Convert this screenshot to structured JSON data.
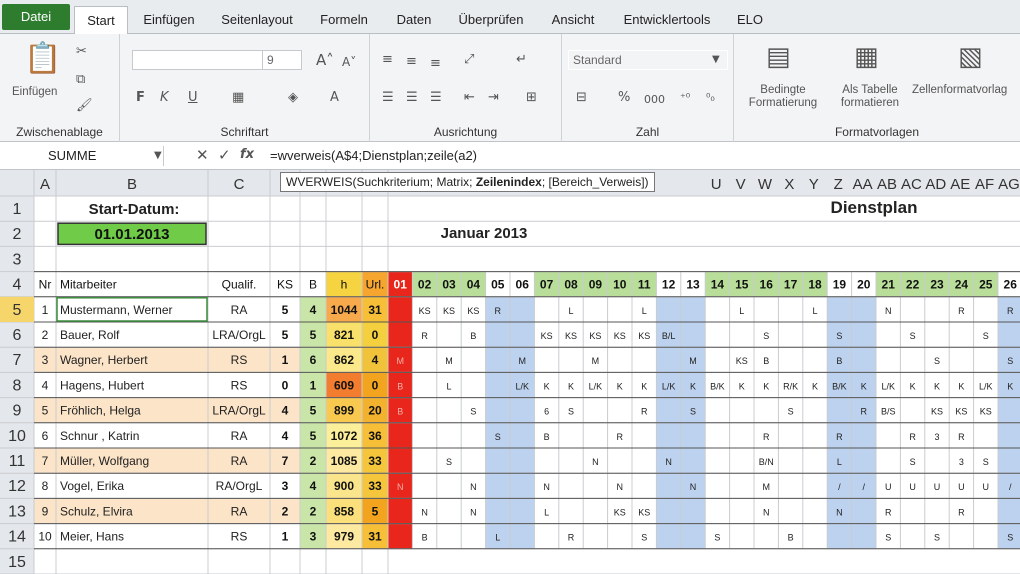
{
  "tabs": [
    "Datei",
    "Start",
    "Einfügen",
    "Seitenlayout",
    "Formeln",
    "Daten",
    "Überprüfen",
    "Ansicht",
    "Entwicklertools",
    "ELO"
  ],
  "ribbon": {
    "paste_label": "Einfügen",
    "clipboard_label": "Zwischenablage",
    "font_size": "9",
    "font_group_label": "Schriftart",
    "bold": "F",
    "italic": "K",
    "underline": "U",
    "align_group_label": "Ausrichtung",
    "number_format": "Standard",
    "percent": "%",
    "thousands": "000",
    "number_group_label": "Zahl",
    "cond_format_label": "Bedingte Formatierung",
    "as_table_label": "Als Tabelle formatieren",
    "cell_styles_label": "Zellenformatvorlag",
    "styles_group_label": "Formatvorlagen"
  },
  "formula_bar": {
    "name_box": "SUMME",
    "fx": "fx",
    "content": "=wverweis(A$4;Dienstplan;zeile(a2)"
  },
  "tooltip": {
    "pre": "WVERWEIS(Suchkriterium; Matrix; ",
    "bold": "Zeilenindex",
    "post": "; [Bereich_Verweis])"
  },
  "sheet": {
    "col_headers": [
      "A",
      "B",
      "C",
      "",
      "",
      "",
      "",
      "",
      "",
      "",
      "",
      "",
      "",
      "",
      "",
      "",
      "",
      "",
      "",
      "",
      "",
      "",
      "",
      "",
      "",
      "",
      "",
      "",
      "U",
      "V",
      "W",
      "X",
      "Y",
      "Z",
      "AA",
      "AB",
      "AC",
      "AD",
      "AE",
      "AF",
      "AG"
    ],
    "row_numbers": [
      "1",
      "2",
      "3",
      "4",
      "5",
      "6",
      "7",
      "8",
      "9",
      "10",
      "11",
      "12",
      "13",
      "14",
      "15"
    ],
    "start_label": "Start-Datum:",
    "start_date": "01.01.2013",
    "month_label": "Januar 2013",
    "plan_title": "Dienstplan",
    "headers": {
      "nr": "Nr",
      "name": "Mitarbeiter",
      "qual": "Qualif.",
      "ks": "KS",
      "b": "B",
      "h": "h",
      "url": "Url."
    },
    "days": [
      "01",
      "02",
      "03",
      "04",
      "05",
      "06",
      "07",
      "08",
      "09",
      "10",
      "11",
      "12",
      "13",
      "14",
      "15",
      "16",
      "17",
      "18",
      "19",
      "20",
      "21",
      "22",
      "23",
      "24",
      "25",
      "26"
    ],
    "weekend_days": [
      "05",
      "06",
      "12",
      "13",
      "19",
      "20",
      "26"
    ],
    "employees": [
      {
        "nr": "1",
        "name": "Mustermann, Werner",
        "qual": "RA",
        "ks": "5",
        "b": "4",
        "h": "1044",
        "url": "31",
        "cells": [
          "",
          "KS",
          "KS",
          "KS",
          "R",
          "",
          "",
          "L",
          "",
          "",
          "L",
          "",
          "",
          "",
          "L",
          "",
          "",
          "L",
          "",
          "",
          "N",
          "",
          "",
          "R",
          "",
          "R"
        ]
      },
      {
        "nr": "2",
        "name": "Bauer, Rolf",
        "qual": "LRA/OrgL",
        "ks": "5",
        "b": "5",
        "h": "821",
        "url": "0",
        "cells": [
          "",
          "R",
          "",
          "B",
          "",
          "",
          "KS",
          "KS",
          "KS",
          "KS",
          "KS",
          "B/L",
          "",
          "",
          "",
          "S",
          "",
          "",
          "S",
          "",
          "",
          "S",
          "",
          "",
          "S",
          ""
        ]
      },
      {
        "nr": "3",
        "name": "Wagner, Herbert",
        "qual": "RS",
        "ks": "1",
        "b": "6",
        "h": "862",
        "url": "4",
        "cells": [
          "M",
          "",
          "M",
          "",
          "",
          "M",
          "",
          "",
          "M",
          "",
          "",
          "",
          "M",
          "",
          "KS",
          "B",
          "",
          "",
          "B",
          "",
          "",
          "",
          "S",
          "",
          "",
          "S"
        ]
      },
      {
        "nr": "4",
        "name": "Hagens, Hubert",
        "qual": "RS",
        "ks": "0",
        "b": "1",
        "h": "609",
        "url": "0",
        "cells": [
          "B",
          "",
          "L",
          "",
          "",
          "L/K",
          "K",
          "K",
          "L/K",
          "K",
          "K",
          "L/K",
          "K",
          "B/K",
          "K",
          "K",
          "R/K",
          "K",
          "B/K",
          "K",
          "L/K",
          "K",
          "K",
          "K",
          "L/K",
          "K"
        ]
      },
      {
        "nr": "5",
        "name": "Fröhlich, Helga",
        "qual": "LRA/OrgL",
        "ks": "4",
        "b": "5",
        "h": "899",
        "url": "20",
        "cells": [
          "B",
          "",
          "",
          "S",
          "",
          "",
          "6",
          "S",
          "",
          "",
          "R",
          "",
          "S",
          "",
          "",
          "",
          "S",
          "",
          "",
          "R",
          "B/S",
          "",
          "KS",
          "KS",
          "KS",
          ""
        ]
      },
      {
        "nr": "6",
        "name": "Schnur , Katrin",
        "qual": "RA",
        "ks": "4",
        "b": "5",
        "h": "1072",
        "url": "36",
        "cells": [
          "",
          "",
          "",
          "",
          "S",
          "",
          "B",
          "",
          "",
          "R",
          "",
          "",
          "",
          "",
          "",
          "R",
          "",
          "",
          "R",
          "",
          "",
          "R",
          "3",
          "R",
          "",
          ""
        ]
      },
      {
        "nr": "7",
        "name": "Müller, Wolfgang",
        "qual": "RA",
        "ks": "7",
        "b": "2",
        "h": "1085",
        "url": "33",
        "cells": [
          "",
          "",
          "S",
          "",
          "",
          "",
          "",
          "",
          "N",
          "",
          "",
          "N",
          "",
          "",
          "",
          "B/N",
          "",
          "",
          "L",
          "",
          "",
          "S",
          "",
          "3",
          "S",
          ""
        ]
      },
      {
        "nr": "8",
        "name": "Vogel, Erika",
        "qual": "RA/OrgL",
        "ks": "3",
        "b": "4",
        "h": "900",
        "url": "33",
        "cells": [
          "N",
          "",
          "",
          "N",
          "",
          "",
          "N",
          "",
          "",
          "N",
          "",
          "",
          "N",
          "",
          "",
          "M",
          "",
          "",
          "/",
          "/",
          "U",
          "U",
          "U",
          "U",
          "U",
          "/"
        ]
      },
      {
        "nr": "9",
        "name": "Schulz, Elvira",
        "qual": "RA",
        "ks": "2",
        "b": "2",
        "h": "858",
        "url": "5",
        "cells": [
          "",
          "N",
          "",
          "N",
          "",
          "",
          "L",
          "",
          "",
          "KS",
          "KS",
          "",
          "",
          "",
          "",
          "N",
          "",
          "",
          "N",
          "",
          "R",
          "",
          "",
          "R",
          "",
          ""
        ]
      },
      {
        "nr": "10",
        "name": "Meier, Hans",
        "qual": "RS",
        "ks": "1",
        "b": "3",
        "h": "979",
        "url": "31",
        "cells": [
          "",
          "B",
          "",
          "",
          "L",
          "",
          "",
          "R",
          "",
          "",
          "S",
          "",
          "",
          "S",
          "",
          "",
          "B",
          "",
          "",
          "",
          "S",
          "",
          "S",
          "",
          "",
          "S"
        ]
      }
    ]
  }
}
